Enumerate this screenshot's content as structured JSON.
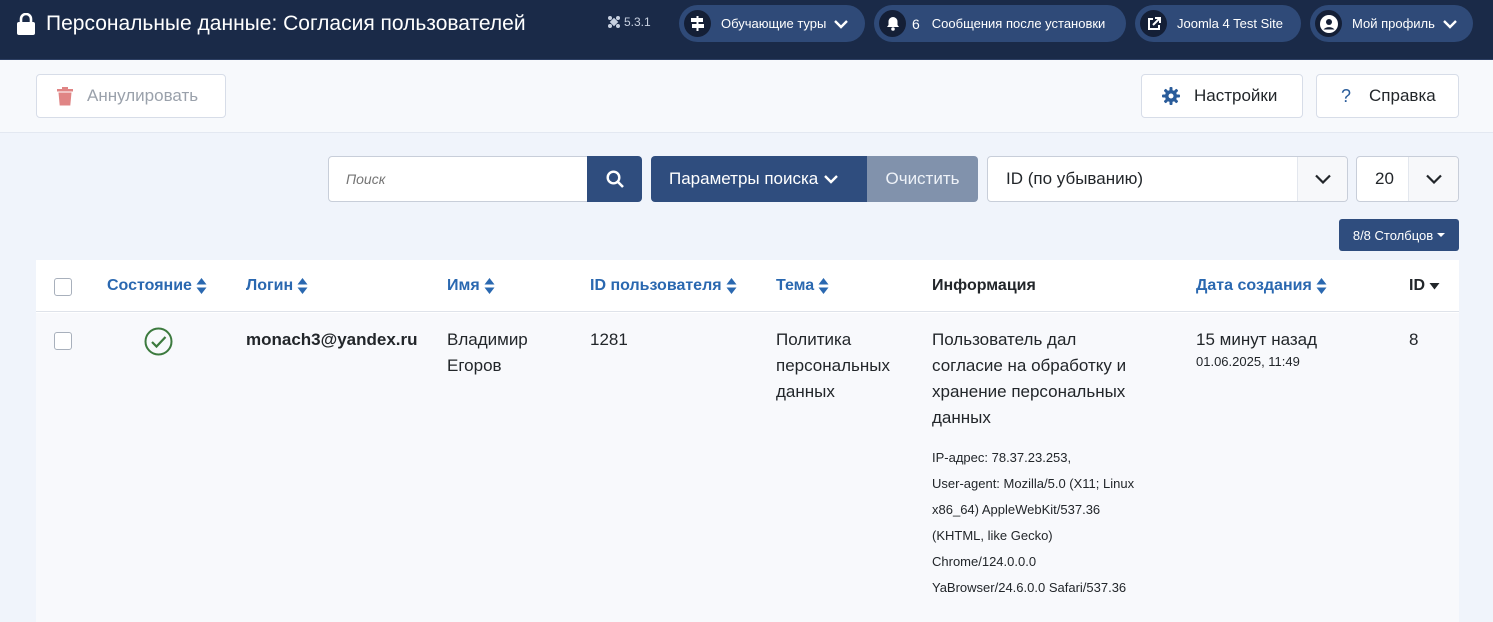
{
  "header": {
    "title": "Персональные данные: Согласия пользователей",
    "version": "5.3.1",
    "tours_label": "Обучающие туры",
    "messages_count": "6",
    "messages_label": "Сообщения после установки",
    "site_label": "Joomla 4 Test Site",
    "profile_label": "Мой профиль"
  },
  "toolbar": {
    "revoke_label": "Аннулировать",
    "settings_label": "Настройки",
    "help_label": "Справка"
  },
  "filters": {
    "search_placeholder": "Поиск",
    "params_label": "Параметры поиска",
    "clear_label": "Очистить",
    "sort_value": "ID (по убыванию)",
    "limit_value": "20",
    "columns_label": "8/8 Столбцов"
  },
  "table": {
    "columns": [
      "Состояние",
      "Логин",
      "Имя",
      "ID пользователя",
      "Тема",
      "Информация",
      "Дата создания",
      "ID"
    ],
    "rows": [
      {
        "login": "monach3@yandex.ru",
        "name_line1": "Владимир",
        "name_line2": "Егоров",
        "user_id": "1281",
        "subject_line1": "Политика",
        "subject_line2": "персональных",
        "subject_line3": "данных",
        "info_line1": "Пользователь дал",
        "info_line2": "согласие на обработку и",
        "info_line3": "хранение персональных",
        "info_line4": "данных",
        "ip": "IP-адрес: 78.37.23.253,",
        "ua_line1": "User-agent: Mozilla/5.0 (X11; Linux",
        "ua_line2": "x86_64) AppleWebKit/537.36",
        "ua_line3": "(KHTML, like Gecko)",
        "ua_line4": "Chrome/124.0.0.0",
        "ua_line5": "YaBrowser/24.6.0.0 Safari/537.36",
        "created_relative": "15 минут назад",
        "created_date": "01.06.2025, 11:49",
        "id": "8"
      }
    ]
  },
  "colors": {
    "header_bg": "#1a2a48",
    "primary": "#2f4d7e",
    "link": "#2a68b0",
    "success": "#3c7a3e",
    "danger_icon": "#e08585"
  }
}
